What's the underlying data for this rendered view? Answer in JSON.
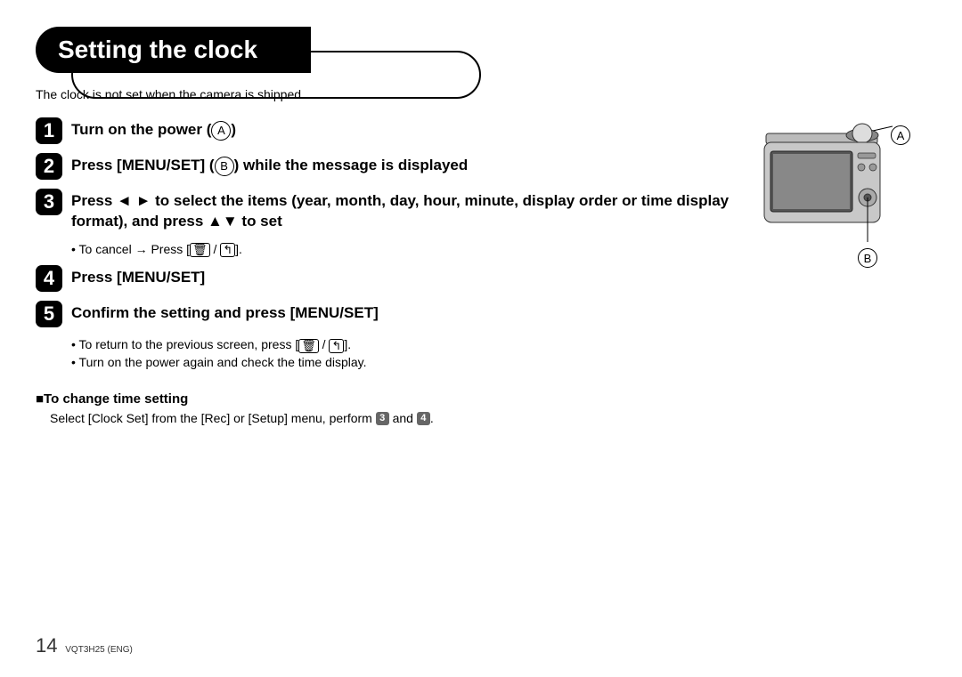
{
  "header": {
    "title": "Setting the clock"
  },
  "intro": "The clock is not set when the camera is shipped.",
  "steps": {
    "s1": {
      "num": "1",
      "text_a": "Turn on the power (",
      "letter": "A",
      "text_b": ")"
    },
    "s2": {
      "num": "2",
      "text_a": "Press [MENU/SET] (",
      "letter": "B",
      "text_b": ") while the message is displayed"
    },
    "s3": {
      "num": "3",
      "text": "Press ◄ ► to select the items (year, month, day, hour, minute, display order or time display format), and press ▲▼ to set"
    },
    "s3_note": {
      "bullet1_a": "To cancel → Press [",
      "trash": "🗑",
      "slash": " / ",
      "back": "↰",
      "bullet1_b": "]."
    },
    "s4": {
      "num": "4",
      "text": "Press [MENU/SET]"
    },
    "s5": {
      "num": "5",
      "text": "Confirm the setting and press [MENU/SET]"
    },
    "s5_note": {
      "bullet1_a": "To return to the previous screen, press [",
      "trash": "🗑",
      "slash": " / ",
      "back": "↰",
      "bullet1_b": "].",
      "bullet2": "Turn on the power again and check the time display."
    }
  },
  "callouts": {
    "A": "A",
    "B": "B"
  },
  "change_section": {
    "heading": "■To change time setting",
    "text_a": "Select [Clock Set] from the [Rec] or [Setup] menu, perform ",
    "ref3": "3",
    "and": " and ",
    "ref4": "4",
    "text_b": "."
  },
  "footer": {
    "page": "14",
    "code": "VQT3H25 (ENG)"
  }
}
